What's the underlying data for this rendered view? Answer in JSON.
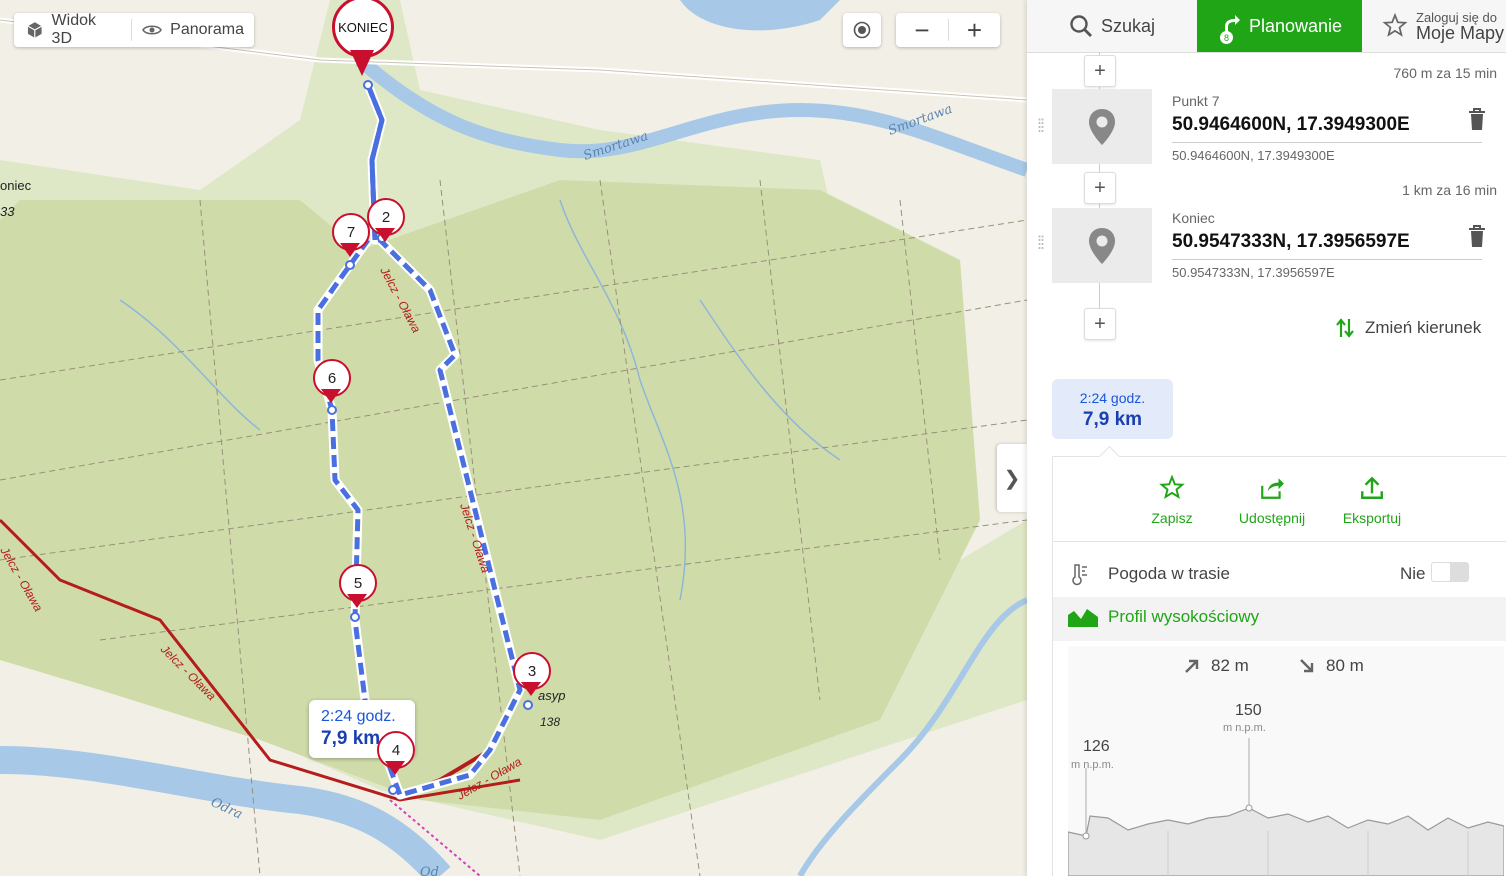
{
  "map": {
    "view_3d_label": "Widok 3D",
    "panorama_label": "Panorama",
    "zoom_out": "−",
    "zoom_in": "+",
    "end_pin_label": "KONIEC",
    "waypoints": [
      "2",
      "3",
      "4",
      "5",
      "6",
      "7"
    ],
    "route_label": {
      "time": "2:24 godz.",
      "distance": "7,9 km"
    },
    "map_labels": {
      "river1": "Smortawa",
      "river2": "Smortawa",
      "river3": "Odra",
      "road1": "Jelcz - Oława",
      "road2": "Jelcz - Oława",
      "road3": "Jelcz - Oława",
      "road4": "Jelcz - Oława",
      "road5": "Jelcz - Oława",
      "left_edge1": "oniec",
      "left_edge2": "33",
      "poi": "asyp",
      "elev": "138",
      "bottom_edge": "Od"
    },
    "toggle_panel": "❯"
  },
  "panel": {
    "tabs": {
      "search": "Szukaj",
      "planning": "Planowanie",
      "planning_badge": "8",
      "login_line1": "Zaloguj się do",
      "login_line2": "Moje Mapy"
    },
    "segments": [
      "760 m za 15 min",
      "1 km za 16 min"
    ],
    "points": [
      {
        "name": "Punkt 7",
        "coords": "50.9464600N, 17.3949300E",
        "sub": "50.9464600N, 17.3949300E"
      },
      {
        "name": "Koniec",
        "coords": "50.9547333N, 17.3956597E",
        "sub": "50.9547333N, 17.3956597E"
      }
    ],
    "reverse_label": "Zmień kierunek",
    "summary": {
      "time": "2:24 godz.",
      "distance": "7,9 km"
    },
    "actions": {
      "save": "Zapisz",
      "share": "Udostępnij",
      "export": "Eksportuj"
    },
    "weather": {
      "label": "Pogoda w trasie",
      "value": "Nie"
    },
    "profile": {
      "title": "Profil wysokościowy",
      "ascent": "82 m",
      "descent": "80 m",
      "start_alt": "126",
      "start_unit": "m n.p.m.",
      "max_alt": "150",
      "max_unit": "m n.p.m."
    }
  },
  "colors": {
    "accent": "#20a517",
    "route": "#4a6fe0",
    "pin": "#c8102e",
    "road": "#b51c1c"
  }
}
